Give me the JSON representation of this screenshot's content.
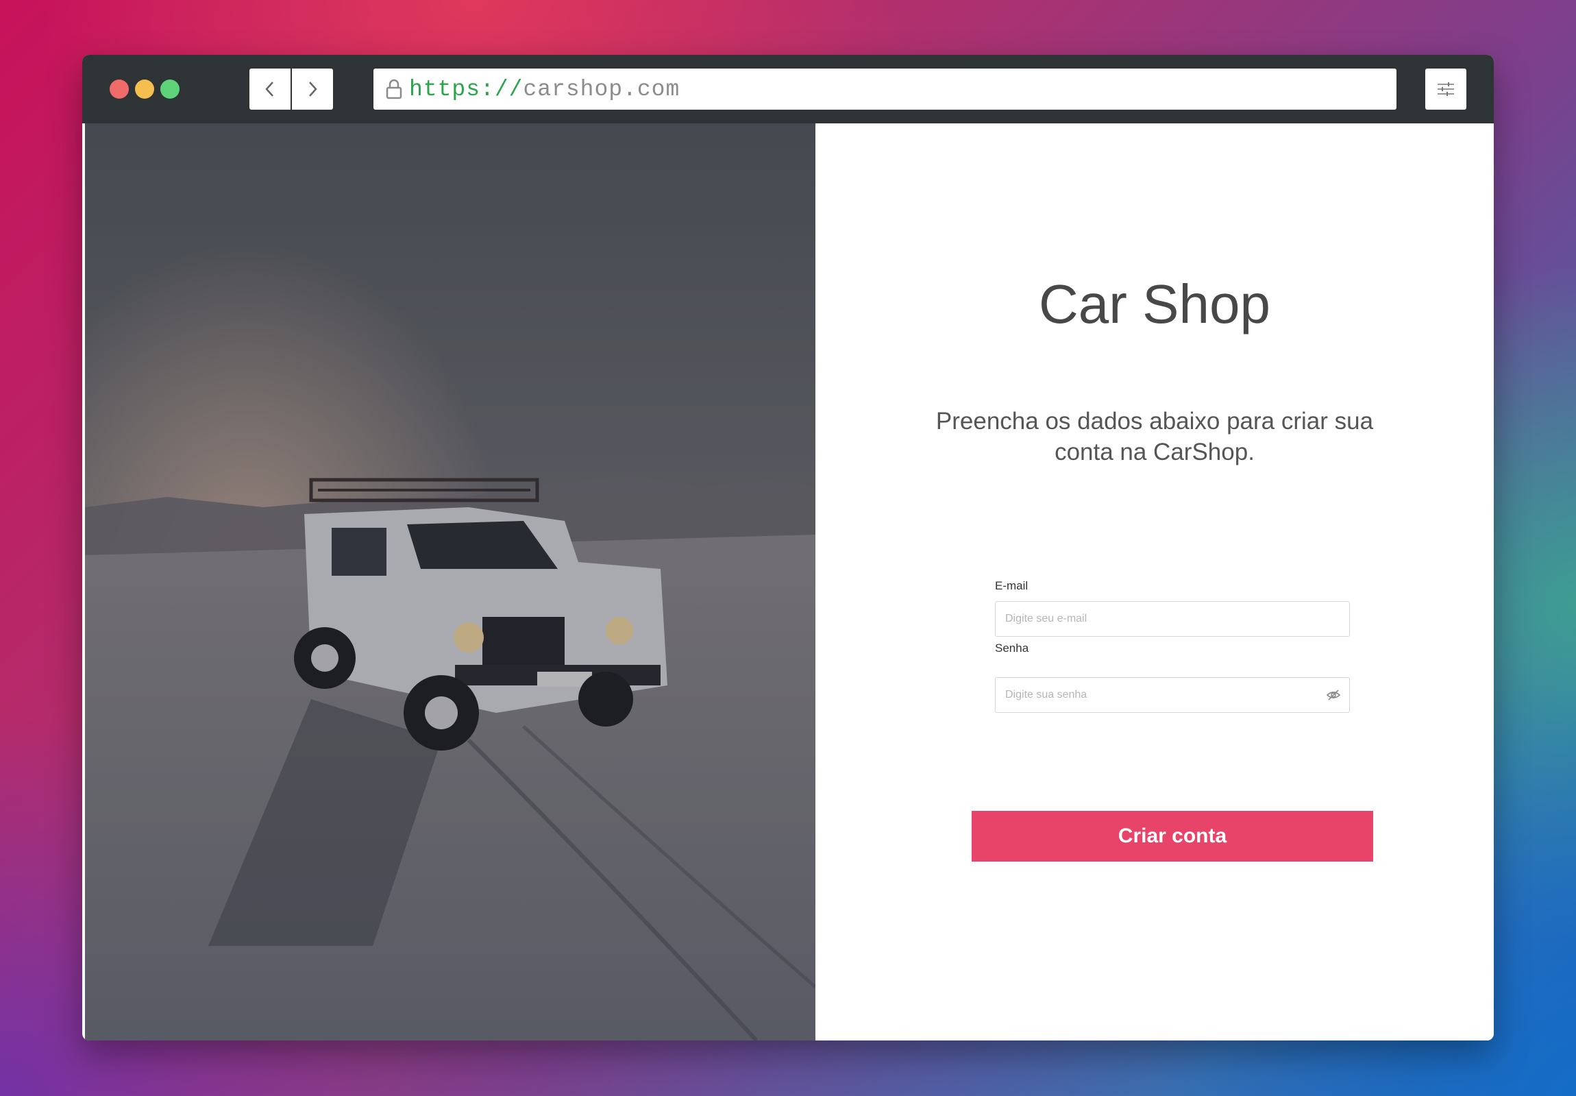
{
  "browser": {
    "url_scheme": "https://",
    "url_host": "carshop.com"
  },
  "page": {
    "brand": "Car Shop",
    "subtitle_line1": "Preencha os dados abaixo para criar sua",
    "subtitle_line2": "conta na CarShop.",
    "email": {
      "label": "E-mail",
      "placeholder": "Digite seu e-mail"
    },
    "password": {
      "label": "Senha",
      "placeholder": "Digite sua senha"
    },
    "submit_label": "Criar conta"
  },
  "colors": {
    "accent": "#e8446a",
    "titlebar": "#2e3336",
    "url_scheme": "#2aa54a"
  },
  "icons": [
    "back-icon",
    "forward-icon",
    "lock-icon",
    "settings-sliders-icon",
    "eye-off-icon"
  ]
}
